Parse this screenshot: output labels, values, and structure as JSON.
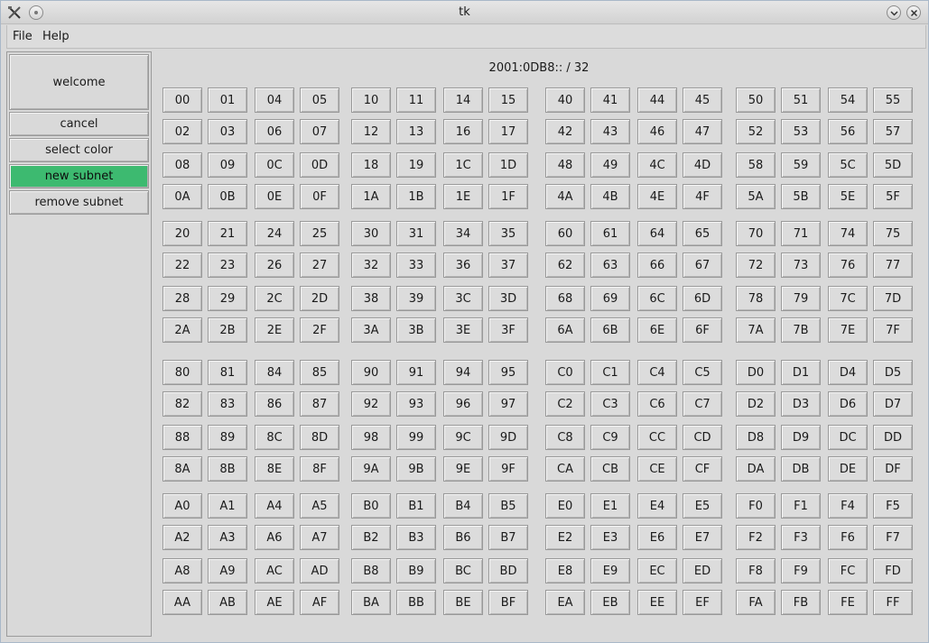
{
  "window": {
    "title": "tk"
  },
  "menubar": {
    "items": [
      "File",
      "Help"
    ]
  },
  "sidebar": {
    "welcome": "welcome",
    "cancel": "cancel",
    "select_color": "select color",
    "new_subnet": "new subnet",
    "remove_subnet": "remove subnet",
    "active_color": "#3dba70"
  },
  "main": {
    "network_label": "2001:0DB8:: / 32"
  },
  "grid": {
    "rows": [
      [
        "00",
        "01",
        "04",
        "05",
        "10",
        "11",
        "14",
        "15",
        "40",
        "41",
        "44",
        "45",
        "50",
        "51",
        "54",
        "55"
      ],
      [
        "02",
        "03",
        "06",
        "07",
        "12",
        "13",
        "16",
        "17",
        "42",
        "43",
        "46",
        "47",
        "52",
        "53",
        "56",
        "57"
      ],
      [
        "08",
        "09",
        "0C",
        "0D",
        "18",
        "19",
        "1C",
        "1D",
        "48",
        "49",
        "4C",
        "4D",
        "58",
        "59",
        "5C",
        "5D"
      ],
      [
        "0A",
        "0B",
        "0E",
        "0F",
        "1A",
        "1B",
        "1E",
        "1F",
        "4A",
        "4B",
        "4E",
        "4F",
        "5A",
        "5B",
        "5E",
        "5F"
      ],
      [
        "20",
        "21",
        "24",
        "25",
        "30",
        "31",
        "34",
        "35",
        "60",
        "61",
        "64",
        "65",
        "70",
        "71",
        "74",
        "75"
      ],
      [
        "22",
        "23",
        "26",
        "27",
        "32",
        "33",
        "36",
        "37",
        "62",
        "63",
        "66",
        "67",
        "72",
        "73",
        "76",
        "77"
      ],
      [
        "28",
        "29",
        "2C",
        "2D",
        "38",
        "39",
        "3C",
        "3D",
        "68",
        "69",
        "6C",
        "6D",
        "78",
        "79",
        "7C",
        "7D"
      ],
      [
        "2A",
        "2B",
        "2E",
        "2F",
        "3A",
        "3B",
        "3E",
        "3F",
        "6A",
        "6B",
        "6E",
        "6F",
        "7A",
        "7B",
        "7E",
        "7F"
      ],
      [
        "80",
        "81",
        "84",
        "85",
        "90",
        "91",
        "94",
        "95",
        "C0",
        "C1",
        "C4",
        "C5",
        "D0",
        "D1",
        "D4",
        "D5"
      ],
      [
        "82",
        "83",
        "86",
        "87",
        "92",
        "93",
        "96",
        "97",
        "C2",
        "C3",
        "C6",
        "C7",
        "D2",
        "D3",
        "D6",
        "D7"
      ],
      [
        "88",
        "89",
        "8C",
        "8D",
        "98",
        "99",
        "9C",
        "9D",
        "C8",
        "C9",
        "CC",
        "CD",
        "D8",
        "D9",
        "DC",
        "DD"
      ],
      [
        "8A",
        "8B",
        "8E",
        "8F",
        "9A",
        "9B",
        "9E",
        "9F",
        "CA",
        "CB",
        "CE",
        "CF",
        "DA",
        "DB",
        "DE",
        "DF"
      ],
      [
        "A0",
        "A1",
        "A4",
        "A5",
        "B0",
        "B1",
        "B4",
        "B5",
        "E0",
        "E1",
        "E4",
        "E5",
        "F0",
        "F1",
        "F4",
        "F5"
      ],
      [
        "A2",
        "A3",
        "A6",
        "A7",
        "B2",
        "B3",
        "B6",
        "B7",
        "E2",
        "E3",
        "E6",
        "E7",
        "F2",
        "F3",
        "F6",
        "F7"
      ],
      [
        "A8",
        "A9",
        "AC",
        "AD",
        "B8",
        "B9",
        "BC",
        "BD",
        "E8",
        "E9",
        "EC",
        "ED",
        "F8",
        "F9",
        "FC",
        "FD"
      ],
      [
        "AA",
        "AB",
        "AE",
        "AF",
        "BA",
        "BB",
        "BE",
        "BF",
        "EA",
        "EB",
        "EE",
        "EF",
        "FA",
        "FB",
        "FE",
        "FF"
      ]
    ]
  }
}
